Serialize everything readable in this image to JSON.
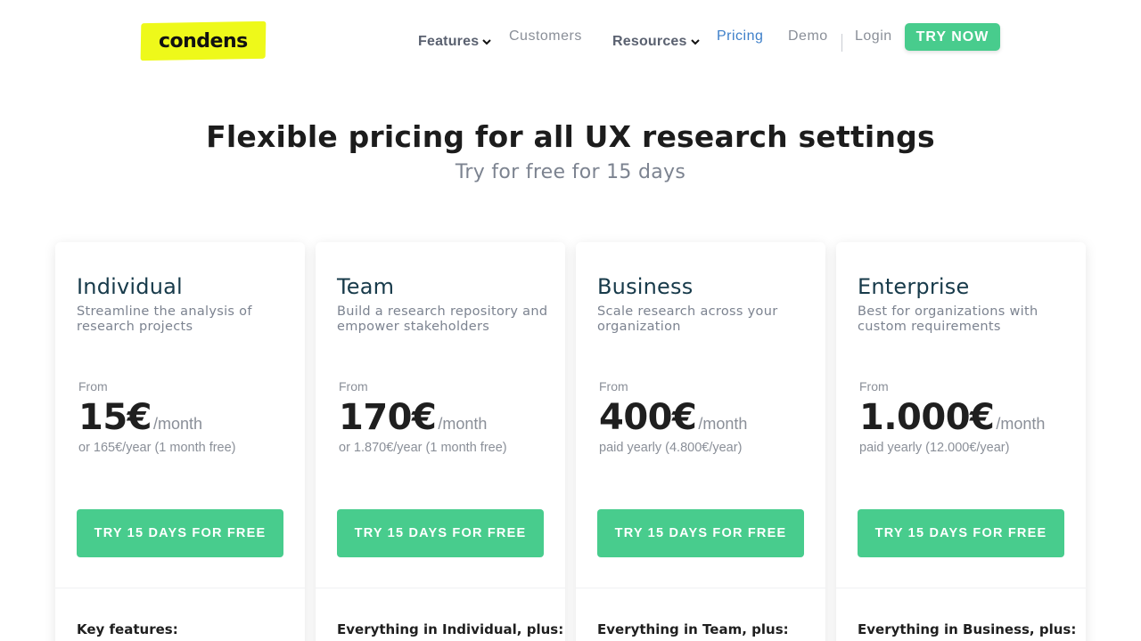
{
  "brand": {
    "logo_text": "condens",
    "logo_color": "#eef91a"
  },
  "nav": {
    "features": "Features",
    "customers": "Customers",
    "resources": "Resources",
    "pricing": "Pricing",
    "demo": "Demo",
    "login": "Login",
    "try_now": "TRY NOW"
  },
  "hero": {
    "title": "Flexible pricing for all UX research settings",
    "subtitle": "Try for free for 15 days"
  },
  "colors": {
    "accent": "#48cc8d",
    "active_link": "#3d7fc9",
    "heading": "#173a4a"
  },
  "plans": [
    {
      "name": "Individual",
      "description": "Streamline the analysis of research projects",
      "from": "From",
      "price": "15€",
      "unit": "/month",
      "note": "or 165€/year (1 month free)",
      "cta": "TRY 15 DAYS FOR FREE",
      "features_heading": "Key features:"
    },
    {
      "name": "Team",
      "description": "Build a research repository and empower stakeholders",
      "from": "From",
      "price": "170€",
      "unit": "/month",
      "note": "or 1.870€/year (1 month free)",
      "cta": "TRY 15 DAYS FOR FREE",
      "features_heading": "Everything in Individual, plus:"
    },
    {
      "name": "Business",
      "description": "Scale research across your organization",
      "from": "From",
      "price": "400€",
      "unit": "/month",
      "note": "paid yearly (4.800€/year)",
      "cta": "TRY 15 DAYS FOR FREE",
      "features_heading": "Everything in Team, plus:"
    },
    {
      "name": "Enterprise",
      "description": "Best for organizations with custom requirements",
      "from": "From",
      "price": "1.000€",
      "unit": "/month",
      "note": "paid yearly (12.000€/year)",
      "cta": "TRY 15 DAYS FOR FREE",
      "features_heading": "Everything in Business, plus:"
    }
  ]
}
